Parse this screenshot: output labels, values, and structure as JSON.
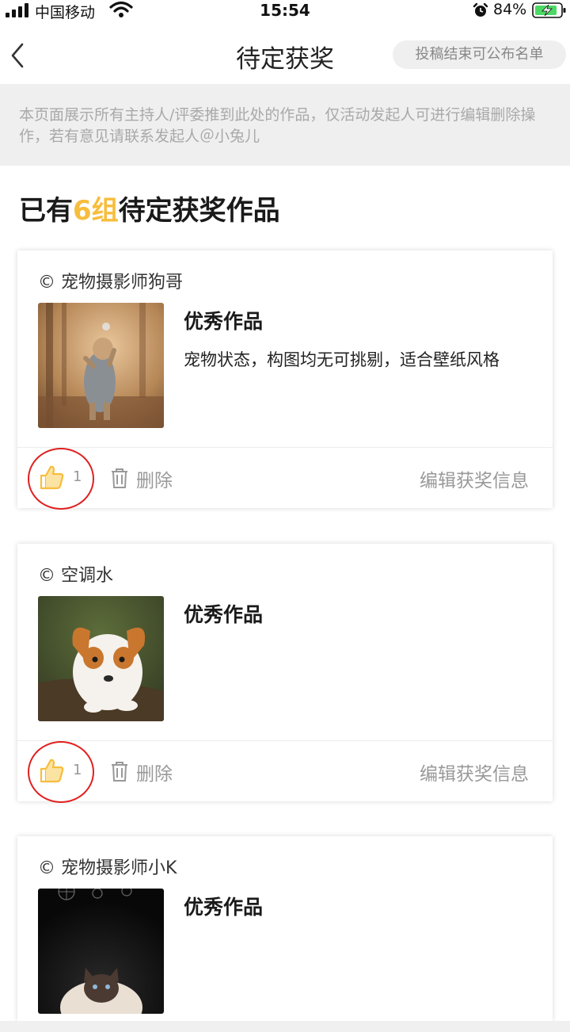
{
  "status_bar": {
    "carrier": "中国移动",
    "time": "15:54",
    "battery": "84%",
    "icons": [
      "signal-icon",
      "wifi-icon",
      "alarm-icon",
      "battery-charging-icon"
    ]
  },
  "nav": {
    "title": "待定获奖",
    "action": "投稿结束可公布名单",
    "back_icon": "chevron-left-icon"
  },
  "notice": "本页面展示所有主持人/评委推到此处的作品，仅活动发起人可进行编辑删除操作，若有意见请联系发起人＠小兔儿",
  "summary": {
    "prefix": "已有",
    "count": "6组",
    "suffix": "待定获奖作品"
  },
  "colors": {
    "accent": "#f7bd3c",
    "annotation_red": "#e02020",
    "muted_text": "#999999",
    "notice_bg": "#efefef"
  },
  "cards": [
    {
      "author": "© 宠物摄影师狗哥",
      "award": "优秀作品",
      "description": "宠物状态，构图均无可挑剔，适合壁纸风格",
      "likes": "1",
      "delete_label": "删除",
      "edit_label": "编辑获奖信息",
      "thumbnail": "yorkie-standing-photo"
    },
    {
      "author": "© 空调水",
      "award": "优秀作品",
      "description": "",
      "likes": "1",
      "delete_label": "删除",
      "edit_label": "编辑获奖信息",
      "thumbnail": "corgi-puppy-photo"
    },
    {
      "author": "© 宠物摄影师小K",
      "award": "优秀作品",
      "description": "",
      "thumbnail": "ragdoll-cat-dark-photo"
    }
  ]
}
